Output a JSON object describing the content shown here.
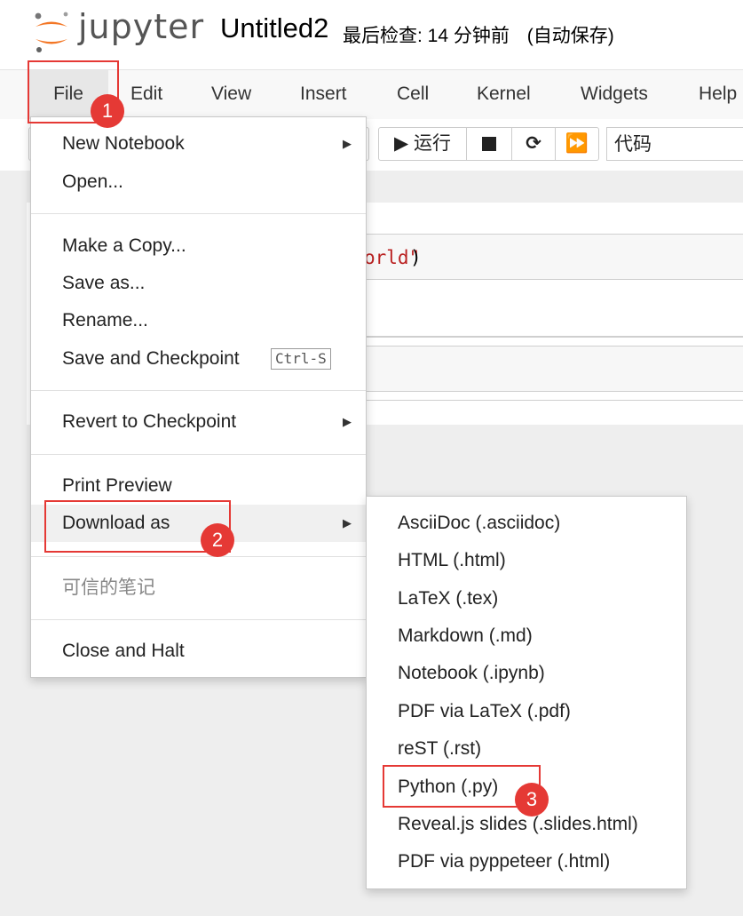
{
  "header": {
    "logo_text": "jupyter",
    "notebook_title": "Untitled2",
    "checkpoint_status": "最后检查: 14 分钟前",
    "autosave_status": "(自动保存)"
  },
  "menubar": {
    "items": [
      "File",
      "Edit",
      "View",
      "Insert",
      "Cell",
      "Kernel",
      "Widgets",
      "Help"
    ]
  },
  "toolbar": {
    "run_label": "运行",
    "cell_type": "代码"
  },
  "notebook": {
    "code_fragment": "orld\"",
    "code_close": ")"
  },
  "file_menu": {
    "items": [
      {
        "label": "New Notebook",
        "submenu": true
      },
      {
        "label": "Open..."
      },
      {
        "label": "Make a Copy..."
      },
      {
        "label": "Save as..."
      },
      {
        "label": "Rename..."
      },
      {
        "label": "Save and Checkpoint",
        "shortcut": "Ctrl-S"
      },
      {
        "label": "Revert to Checkpoint",
        "submenu": true
      },
      {
        "label": "Print Preview"
      },
      {
        "label": "Download as",
        "submenu": true,
        "active": true
      },
      {
        "label": "可信的笔记",
        "disabled": true
      },
      {
        "label": "Close and Halt"
      }
    ]
  },
  "download_submenu": {
    "items": [
      "AsciiDoc (.asciidoc)",
      "HTML (.html)",
      "LaTeX (.tex)",
      "Markdown (.md)",
      "Notebook (.ipynb)",
      "PDF via LaTeX (.pdf)",
      "reST (.rst)",
      "Python (.py)",
      "Reveal.js slides (.slides.html)",
      "PDF via pyppeteer (.html)"
    ]
  },
  "annotations": {
    "step1": "1",
    "step2": "2",
    "step3": "3",
    "highlight_color": "#e53935"
  },
  "icons": {
    "submenu_arrow": "chevron-right-icon",
    "run": "play-icon",
    "stop": "stop-icon",
    "restart": "restart-icon",
    "fast_forward": "fast-forward-icon"
  }
}
